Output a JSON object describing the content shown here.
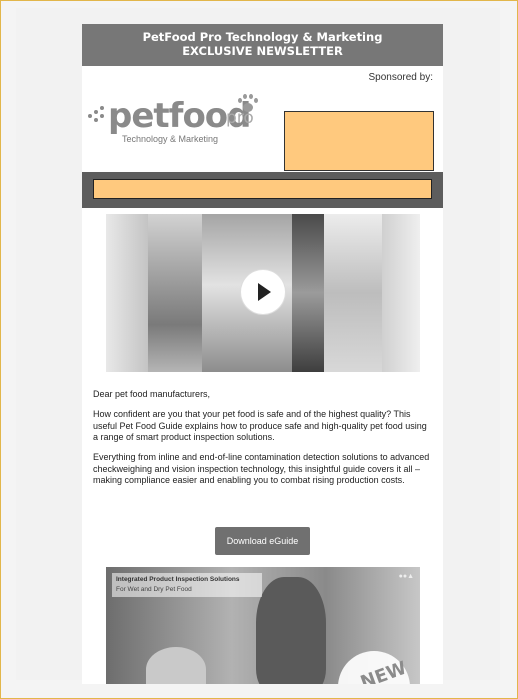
{
  "header": {
    "line1": "PetFood Pro Technology & Marketing",
    "line2": "EXCLUSIVE NEWSLETTER"
  },
  "sponsor": {
    "label": "Sponsored by:"
  },
  "logo": {
    "main": "petfood",
    "pro": "pro",
    "tagline": "Technology & Marketing"
  },
  "video": {
    "play_icon": "play-icon"
  },
  "body": {
    "greeting": "Dear pet food manufacturers,",
    "para1": "How confident are you that your pet food is safe and of the highest quality? This useful Pet Food Guide explains how to produce safe and high-quality pet food using a range of smart product inspection solutions.",
    "para2": "Everything from inline and end-of-line contamination detection solutions to advanced checkweighing and vision inspection technology, this insightful guide covers it all –making compliance easier and enabling you to combat rising production costs."
  },
  "cta": {
    "label": "Download eGuide"
  },
  "promo": {
    "title": "Integrated Product Inspection Solutions",
    "subtitle": "For Wet and Dry Pet Food",
    "badge": "NEW"
  },
  "colors": {
    "banner": "#777777",
    "redaction": "#ffc97e",
    "cta": "#707070"
  }
}
